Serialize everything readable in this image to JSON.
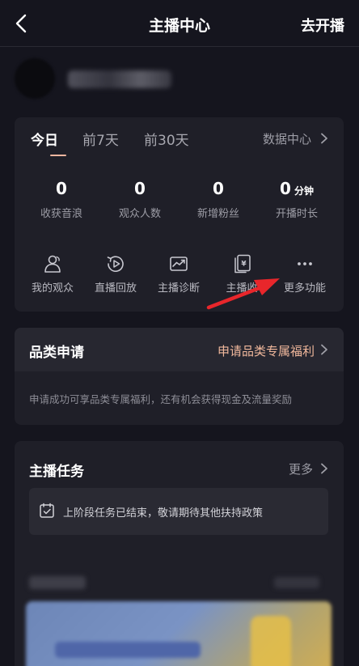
{
  "header": {
    "title": "主播中心",
    "action_label": "去开播"
  },
  "tabs": [
    {
      "label": "今日",
      "active": true
    },
    {
      "label": "前7天",
      "active": false
    },
    {
      "label": "前30天",
      "active": false
    }
  ],
  "data_center_label": "数据中心",
  "stats": [
    {
      "value": "0",
      "unit": "",
      "label": "收获音浪"
    },
    {
      "value": "0",
      "unit": "",
      "label": "观众人数"
    },
    {
      "value": "0",
      "unit": "",
      "label": "新增粉丝"
    },
    {
      "value": "0",
      "unit": "分钟",
      "label": "开播时长"
    }
  ],
  "functions": [
    {
      "label": "我的观众",
      "icon": "audience-icon"
    },
    {
      "label": "直播回放",
      "icon": "replay-icon"
    },
    {
      "label": "主播诊断",
      "icon": "diagnosis-icon"
    },
    {
      "label": "主播收",
      "icon": "income-icon"
    },
    {
      "label": "更多功能",
      "icon": "more-icon"
    }
  ],
  "category": {
    "title": "品类申请",
    "link_label": "申请品类专属福利",
    "description": "申请成功可享品类专属福利，还有机会获得现金及流量奖励"
  },
  "tasks": {
    "title": "主播任务",
    "more_label": "更多",
    "notice": "上阶段任务已结束，敬请期待其他扶持政策"
  },
  "colors": {
    "background": "#15151e",
    "card": "#1f1f28",
    "accent": "#f1b89c",
    "arrow": "#e8262b"
  }
}
